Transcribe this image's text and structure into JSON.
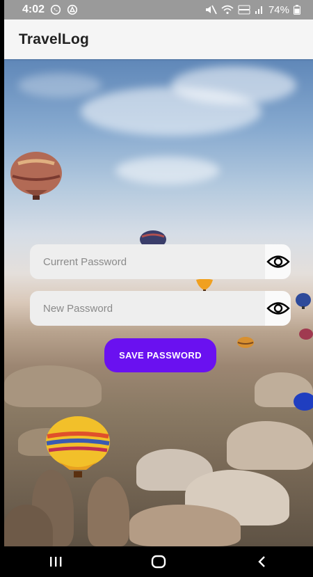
{
  "status_bar": {
    "time": "4:02",
    "battery": "74%",
    "icons": [
      "whatsapp-icon",
      "notification-icon",
      "mute-icon",
      "wifi-icon",
      "volte-icon",
      "signal-icon",
      "battery-icon"
    ]
  },
  "app_bar": {
    "title": "TravelLog"
  },
  "form": {
    "current_password": {
      "placeholder": "Current Password",
      "value": ""
    },
    "new_password": {
      "placeholder": "New Password",
      "value": ""
    },
    "eye_icon": "eye-icon",
    "save_label": "SAVE PASSWORD"
  },
  "nav_bar": {
    "icons": [
      "recent-apps-icon",
      "home-icon",
      "back-icon"
    ]
  },
  "colors": {
    "accent": "#6a11f0",
    "app_bar_bg": "#f5f5f5",
    "status_bar_bg": "#9a9a9a",
    "field_bg": "#eeeeee"
  }
}
